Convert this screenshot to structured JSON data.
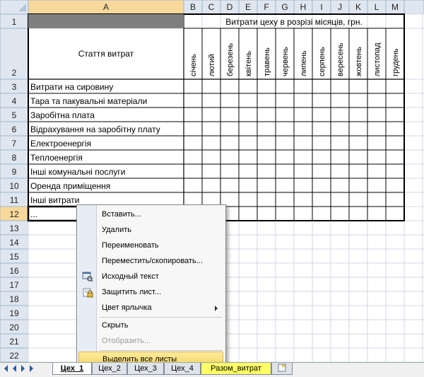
{
  "columns": [
    "A",
    "B",
    "C",
    "D",
    "E",
    "F",
    "G",
    "H",
    "I",
    "J",
    "K",
    "L",
    "M"
  ],
  "rows": [
    "1",
    "2",
    "3",
    "4",
    "5",
    "6",
    "7",
    "8",
    "9",
    "10",
    "11",
    "12",
    "13",
    "14",
    "15",
    "16",
    "17",
    "18",
    "19",
    "20",
    "21",
    "22"
  ],
  "header_title": "Витрати цеху в розрізі місяців, грн.",
  "item_header": "Стаття витрат",
  "months": [
    "січень",
    "лютий",
    "березень",
    "квітень",
    "травень",
    "червень",
    "липень",
    "серпень",
    "вересень",
    "жовтень",
    "листопад",
    "грудень"
  ],
  "items": [
    "Витрати на сировину",
    "Тара та пакувальні матеріали",
    "Заробітна плата",
    "Відрахування на заробітну плату",
    "Електроенергія",
    "Теплоенергія",
    "Інші комунальні послуги",
    "Оренда приміщення",
    "Інші витрати",
    "..."
  ],
  "context_menu": {
    "insert": "Вставить...",
    "delete": "Удалить",
    "rename": "Переименовать",
    "move_copy": "Переместить/скопировать...",
    "source": "Исходный текст",
    "protect": "Защитить лист...",
    "tab_color": "Цвет ярлычка",
    "hide": "Скрыть",
    "unhide": "Отобразить...",
    "select_all": "Выделить все листы"
  },
  "tabs": [
    "Цех_1",
    "Цех_2",
    "Цех_3",
    "Цех_4",
    "Разом_витрат"
  ],
  "colors": {
    "header_bg": "#dfe6ef",
    "selected_header_bg": "#f9d99b",
    "grid_line": "#d0d7e5",
    "title_fill": "#7f7f7f",
    "highlight": "#f8d667",
    "active_tab": "#ffffff",
    "total_tab": "#ffff66"
  }
}
